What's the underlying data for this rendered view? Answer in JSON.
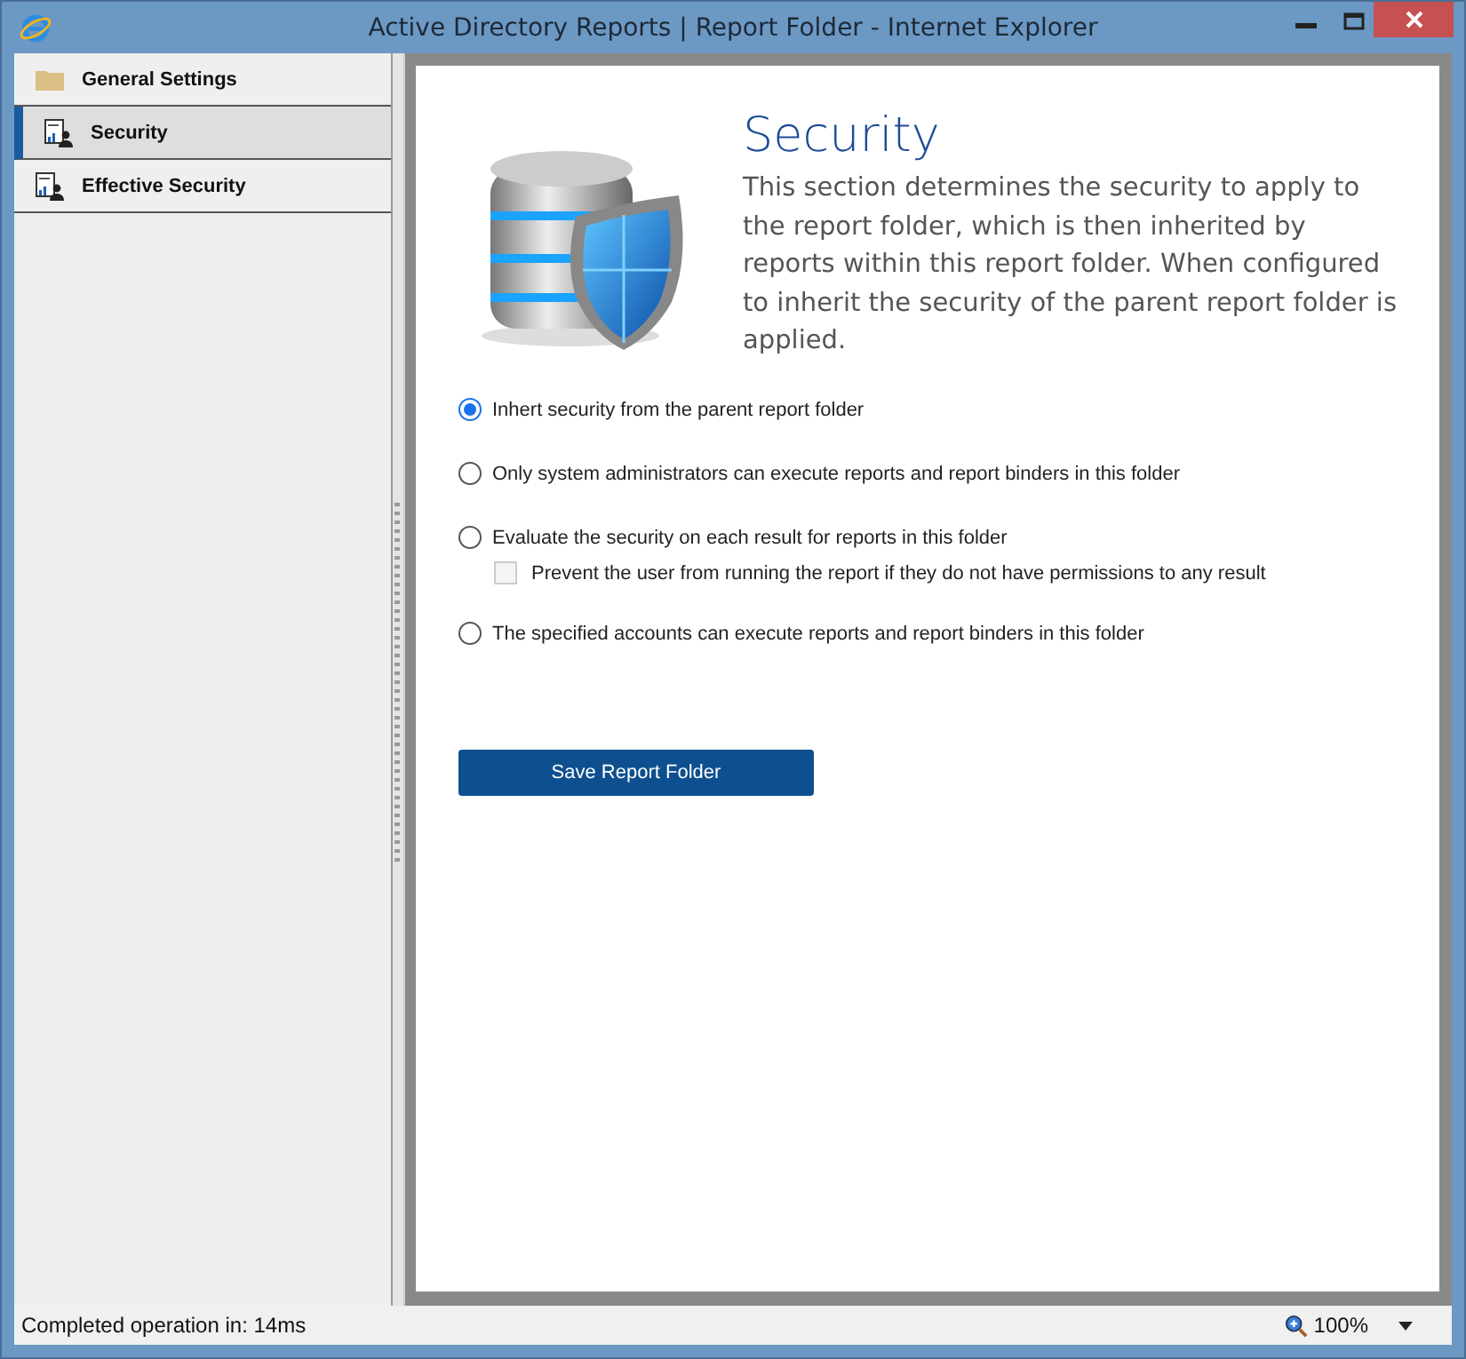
{
  "window": {
    "title": "Active Directory Reports | Report Folder - Internet Explorer"
  },
  "sidebar": {
    "items": [
      {
        "label": "General Settings",
        "kind": "folder",
        "selected": false
      },
      {
        "label": "Security",
        "kind": "report",
        "selected": true
      },
      {
        "label": "Effective Security",
        "kind": "report",
        "selected": false
      }
    ]
  },
  "content": {
    "title": "Security",
    "description": "This section determines the security to apply to the report folder, which is then inherited by reports within this report folder. When configured to inherit the security of the parent report folder is applied.",
    "options": [
      {
        "label": "Inhert security from the parent report folder",
        "selected": true
      },
      {
        "label": "Only system administrators can execute reports and report binders in this folder",
        "selected": false
      },
      {
        "label": "Evaluate the security on each result for reports in this folder",
        "selected": false,
        "sub_option": {
          "label": "Prevent the user from running the report if they do not have permissions to any result",
          "checked": false,
          "disabled": true
        }
      },
      {
        "label": "The specified accounts can execute reports and report binders in this folder",
        "selected": false
      }
    ],
    "save_button": "Save Report Folder"
  },
  "status_bar": {
    "text": "Completed operation in: 14ms",
    "zoom": "100%"
  }
}
